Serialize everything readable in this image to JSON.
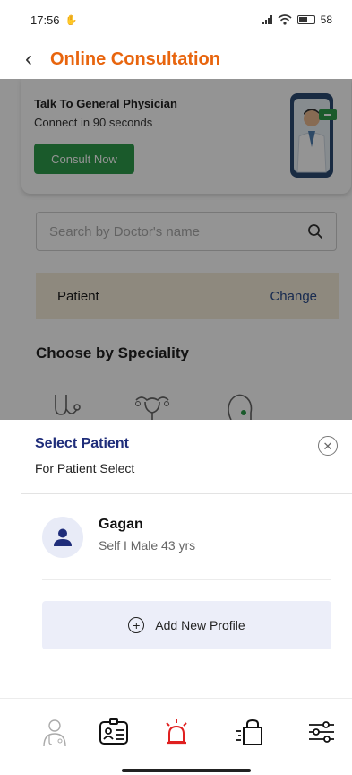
{
  "status_bar": {
    "time": "17:56",
    "battery": "58"
  },
  "header": {
    "title": "Online Consultation"
  },
  "promo": {
    "title": "Talk To General Physician",
    "subtitle": "Connect in 90 seconds",
    "button_label": "Consult Now"
  },
  "search": {
    "placeholder": "Search by Doctor's name"
  },
  "patient_bar": {
    "label": "Patient",
    "action": "Change"
  },
  "speciality": {
    "title": "Choose by Speciality"
  },
  "sheet": {
    "title": "Select Patient",
    "subtitle": "For Patient Select",
    "patients": [
      {
        "name": "Gagan",
        "meta": "Self I Male 43 yrs"
      }
    ],
    "add_label": "Add New Profile"
  },
  "bottom_nav": {
    "items": [
      "doctor-icon",
      "id-card-icon",
      "alarm-icon",
      "shopping-bag-icon",
      "filter-icon"
    ],
    "active_color": "#e02020"
  },
  "colors": {
    "title": "#e8650e",
    "accent_green": "#2e9b4a",
    "sheet_title": "#1f2d7a"
  }
}
